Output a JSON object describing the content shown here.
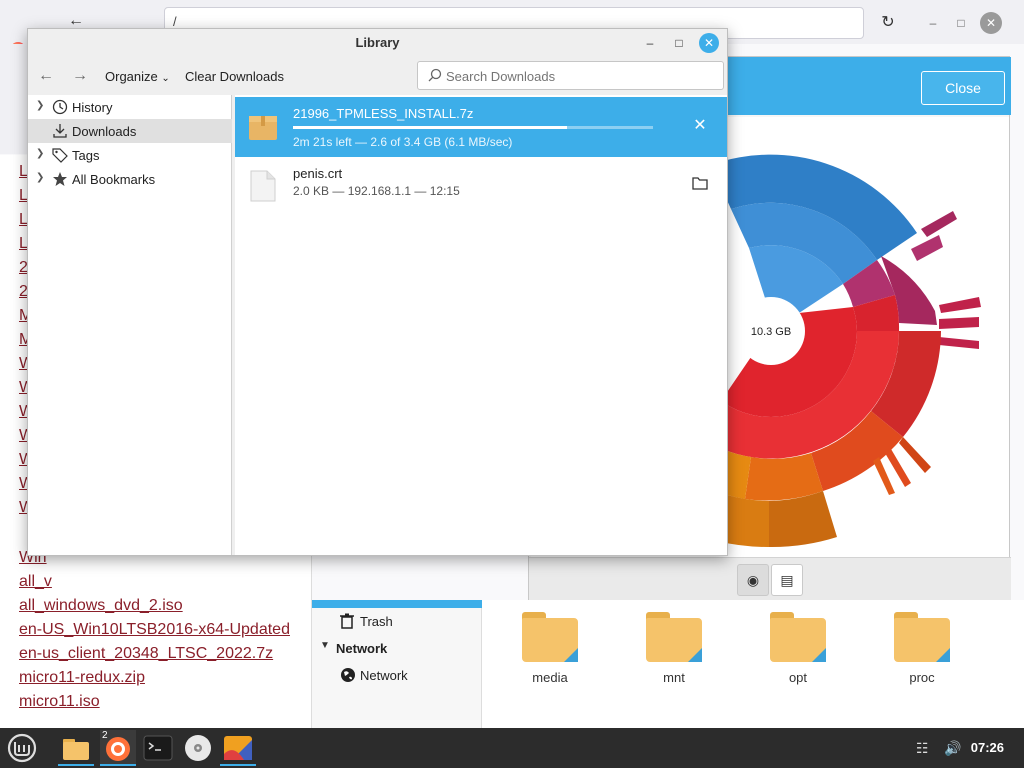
{
  "browser": {
    "url": "/",
    "file_links": [
      "L",
      "L",
      "L",
      "L",
      "2",
      "2",
      "M",
      "M",
      "W",
      "W",
      "W",
      "W",
      "W",
      "W",
      "W",
      "Win",
      "all_v",
      "all_windows_dvd_2.iso",
      "en-US_Win10LTSB2016-x64-Updated",
      "en-us_client_20348_LTSC_2022.7z",
      "micro11-redux.zip",
      "micro11.iso"
    ]
  },
  "disk_usage": {
    "close_label": "Close",
    "total": "10.3 GB",
    "view_buttons": [
      "rings-chart-icon",
      "treemap-chart-icon"
    ]
  },
  "files": {
    "sidebar": {
      "trash_label": "Trash",
      "network_header": "Network",
      "network_item": "Network"
    },
    "folders": [
      "media",
      "mnt",
      "opt",
      "proc"
    ]
  },
  "library": {
    "title": "Library",
    "toolbar": {
      "organize": "Organize",
      "clear_downloads": "Clear Downloads",
      "search_placeholder": "Search Downloads"
    },
    "sidebar": [
      {
        "label": "History",
        "icon": "clock-icon",
        "expandable": true
      },
      {
        "label": "Downloads",
        "icon": "download-icon",
        "expandable": false,
        "selected": true
      },
      {
        "label": "Tags",
        "icon": "tag-icon",
        "expandable": true
      },
      {
        "label": "All Bookmarks",
        "icon": "star-icon",
        "expandable": true
      }
    ],
    "downloads": [
      {
        "name": "21996_TPMLESS_INSTALL.7z",
        "status": "2m 21s left — 2.6 of 3.4 GB (6.1 MB/sec)",
        "progress": 0.76,
        "action": "cancel-icon"
      },
      {
        "name": "penis.crt",
        "status": "2.0 KB — 192.168.1.1 — 12:15",
        "action": "open-folder-icon"
      }
    ]
  },
  "taskbar": {
    "firefox_badge": "2",
    "clock": "07:26"
  }
}
